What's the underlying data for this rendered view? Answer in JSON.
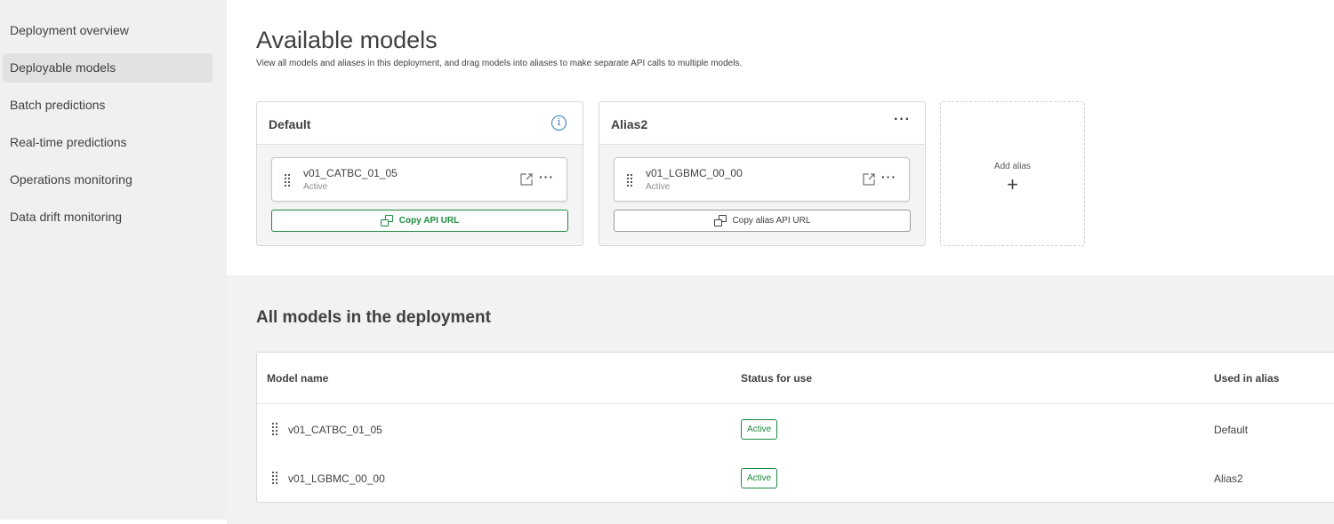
{
  "sidebar": {
    "items": [
      {
        "label": "Deployment overview",
        "active": false
      },
      {
        "label": "Deployable models",
        "active": true
      },
      {
        "label": "Batch predictions",
        "active": false
      },
      {
        "label": "Real-time predictions",
        "active": false
      },
      {
        "label": "Operations monitoring",
        "active": false
      },
      {
        "label": "Data drift monitoring",
        "active": false
      }
    ]
  },
  "header": {
    "title": "Available models",
    "description": "View all models and aliases in this deployment, and drag models into aliases to make separate API calls to multiple models."
  },
  "aliases": [
    {
      "name": "Default",
      "header_icon": "info-icon",
      "model": {
        "name": "v01_CATBC_01_05",
        "status": "Active"
      },
      "copy_label": "Copy API URL"
    },
    {
      "name": "Alias2",
      "header_icon": "more-icon",
      "header_more": "···",
      "model": {
        "name": "v01_LGBMC_00_00",
        "status": "Active"
      },
      "copy_label": "Copy alias API URL"
    }
  ],
  "chip_more": "···",
  "add_alias": {
    "label": "Add alias",
    "plus": "+"
  },
  "models_section": {
    "title": "All models in the deployment",
    "columns": [
      "Model name",
      "Status for use",
      "Used in alias"
    ],
    "rows": [
      {
        "name": "v01_CATBC_01_05",
        "status": "Active",
        "alias": "Default"
      },
      {
        "name": "v01_LGBMC_00_00",
        "status": "Active",
        "alias": "Alias2"
      }
    ]
  },
  "colors": {
    "accent_green": "#1d8a3f",
    "info_blue": "#2f7ac0",
    "sidebar_bg": "#f0f0f0"
  }
}
